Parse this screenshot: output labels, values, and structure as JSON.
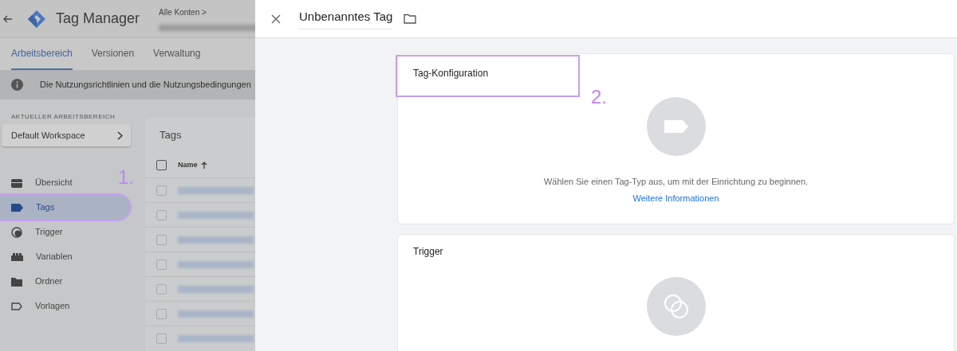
{
  "app": {
    "title": "Tag Manager",
    "breadcrumb": "Alle Konten >"
  },
  "tabs": [
    {
      "label": "Arbeitsbereich",
      "selected": true
    },
    {
      "label": "Versionen",
      "selected": false
    },
    {
      "label": "Verwaltung",
      "selected": false
    }
  ],
  "notice": "Die Nutzungsrichtlinien und die Nutzungsbedingungen",
  "workspace": {
    "heading": "AKTUELLER ARBEITSBEREICH",
    "name": "Default Workspace"
  },
  "nav": [
    {
      "label": "Übersicht",
      "kind": "overview",
      "selected": false,
      "marked": false
    },
    {
      "label": "Tags",
      "kind": "tag",
      "selected": true,
      "marked": true
    },
    {
      "label": "Trigger",
      "kind": "trigger",
      "selected": false,
      "marked": false
    },
    {
      "label": "Variablen",
      "kind": "variables",
      "selected": false,
      "marked": false
    },
    {
      "label": "Ordner",
      "kind": "folder",
      "selected": false,
      "marked": false
    },
    {
      "label": "Vorlagen",
      "kind": "template",
      "selected": false,
      "marked": false
    }
  ],
  "tags_table": {
    "title": "Tags",
    "column": "Name",
    "all_checked": false,
    "rows": [
      {
        "checked": false
      },
      {
        "checked": false
      },
      {
        "checked": false
      },
      {
        "checked": false
      },
      {
        "checked": false
      },
      {
        "checked": false
      },
      {
        "checked": false
      }
    ]
  },
  "editor": {
    "title": "Unbenanntes Tag",
    "cards": [
      {
        "title": "Tag-Konfiguration",
        "kind": "tag",
        "marked": true,
        "hint": "Wählen Sie einen Tag-Typ aus, um mit der Einrichtung zu beginnen.",
        "link": "Weitere Informationen"
      },
      {
        "title": "Trigger",
        "kind": "trigger",
        "marked": false
      }
    ]
  },
  "annotations": [
    {
      "label": "1."
    },
    {
      "label": "2."
    }
  ]
}
